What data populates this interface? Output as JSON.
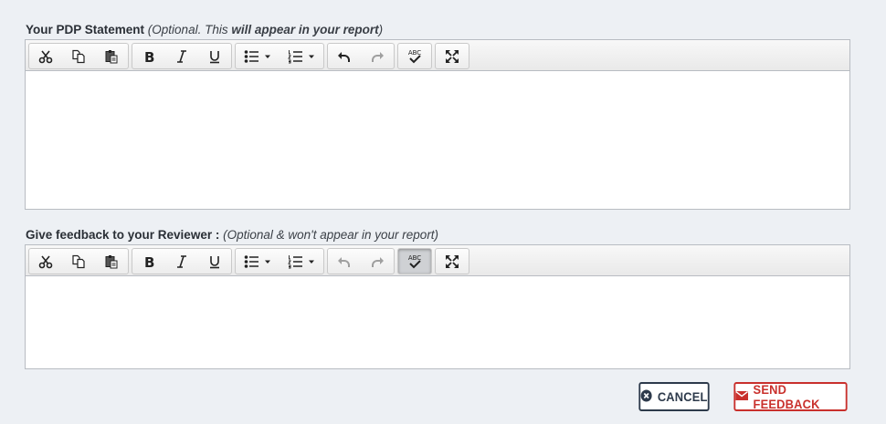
{
  "pdp": {
    "label_main": "Your PDP Statement",
    "label_note_open": "(Optional. This ",
    "label_note_bold": "will appear in your report",
    "label_note_close": ")"
  },
  "reviewer": {
    "label_main": "Give feedback to your Reviewer :",
    "label_note": "(Optional & won't appear in your report)"
  },
  "toolbar": {
    "icons": [
      "cut-icon",
      "copy-icon",
      "paste-icon",
      "bold-icon",
      "italic-icon",
      "underline-icon",
      "bulleted-list-icon",
      "numbered-list-icon",
      "undo-icon",
      "redo-icon",
      "spellcheck-icon",
      "maximize-icon"
    ],
    "spellcheck_text": "ABC"
  },
  "actions": {
    "cancel_label": "CANCEL",
    "send_label": "SEND FEEDBACK",
    "cancel_color": "#2d3a4b",
    "send_color": "#c9302c"
  }
}
